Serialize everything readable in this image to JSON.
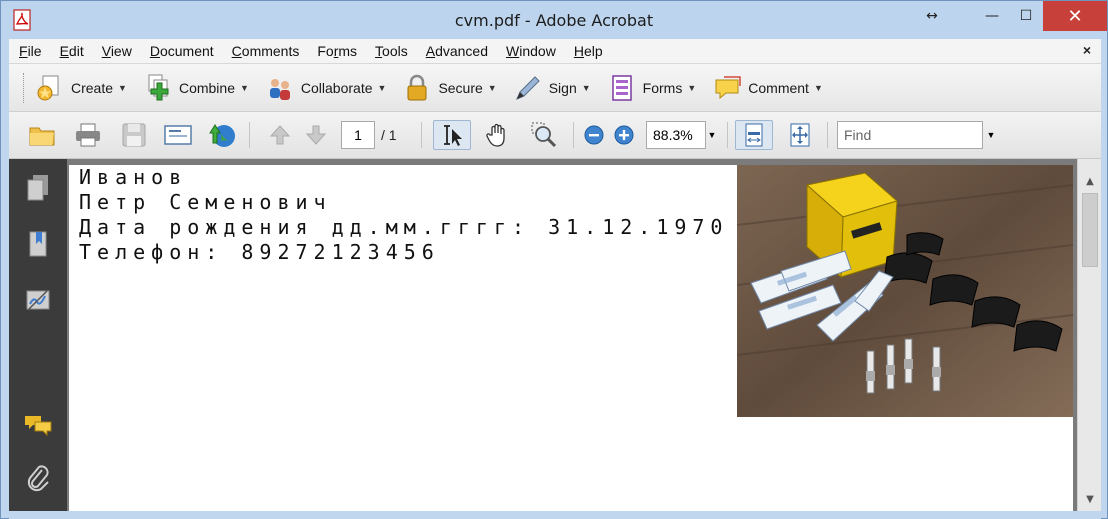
{
  "window": {
    "title": "cvm.pdf - Adobe Acrobat",
    "controls": {
      "restore_arrows": "↔",
      "minimize": "—",
      "maximize": "☐",
      "close": "✕"
    }
  },
  "menu": {
    "items": [
      {
        "u": "F",
        "rest": "ile"
      },
      {
        "u": "E",
        "rest": "dit"
      },
      {
        "u": "V",
        "rest": "iew"
      },
      {
        "u": "D",
        "rest": "ocument"
      },
      {
        "u": "C",
        "rest": "omments"
      },
      {
        "pre": "Fo",
        "u": "r",
        "rest": "ms"
      },
      {
        "u": "T",
        "rest": "ools"
      },
      {
        "u": "A",
        "rest": "dvanced"
      },
      {
        "u": "W",
        "rest": "indow"
      },
      {
        "u": "H",
        "rest": "elp"
      }
    ],
    "close_glyph": "×"
  },
  "tasks": {
    "create": "Create",
    "combine": "Combine",
    "collaborate": "Collaborate",
    "secure": "Secure",
    "sign": "Sign",
    "forms": "Forms",
    "comment": "Comment",
    "caret": "▼"
  },
  "nav": {
    "page_current": "1",
    "page_total": "/ 1",
    "zoom": "88.3%",
    "find_placeholder": "Find",
    "caret": "▼"
  },
  "document": {
    "lines": [
      "Иванов",
      "Петр Семенович",
      "Дата рождения дд.мм.гггг: 31.12.1970",
      "Телефон: 89272123456"
    ]
  },
  "scrollbar": {
    "up": "▲",
    "down": "▼"
  }
}
